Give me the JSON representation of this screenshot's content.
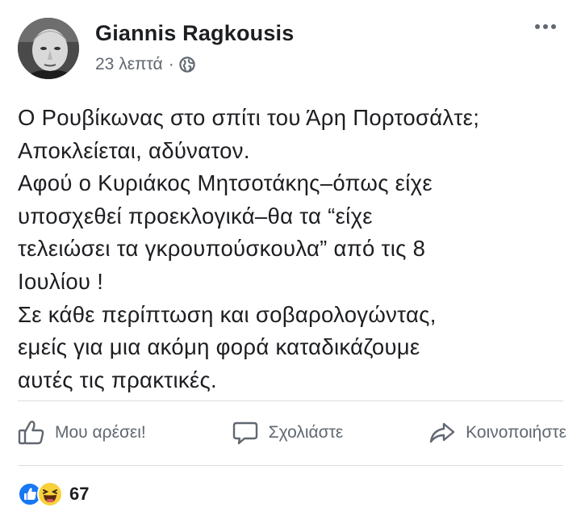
{
  "post": {
    "author": "Giannis Ragkousis",
    "time": "23 λεπτά",
    "separator": "·",
    "privacy_icon": "globe-icon",
    "lines": [
      "Ο Ρουβίκωνας στο σπίτι του Άρη Πορτοσάλτε;",
      "Αποκλείεται, αδύνατον.",
      "Αφού ο Κυριάκος Μητσοτάκης–όπως είχε",
      "υποσχεθεί προεκλογικά–θα τα “είχε",
      "τελειώσει τα γκρουπούσκουλα” από τις 8",
      "Ιουλίου !",
      "Σε κάθε περίπτωση και σοβαρολογώντας,",
      "εμείς για μια ακόμη φορά καταδικάζουμε",
      "αυτές τις πρακτικές."
    ]
  },
  "actions": {
    "like": "Μου αρέσει!",
    "comment": "Σχολιάστε",
    "share": "Κοινοποιήστε"
  },
  "reactions": {
    "count": "67",
    "icons": [
      "like-reaction-icon",
      "haha-reaction-icon"
    ]
  },
  "colors": {
    "text": "#1c1e21",
    "secondary": "#606770",
    "divider": "#dadde1",
    "like_blue": "#1877f2",
    "haha_yellow": "#f7d13b"
  }
}
